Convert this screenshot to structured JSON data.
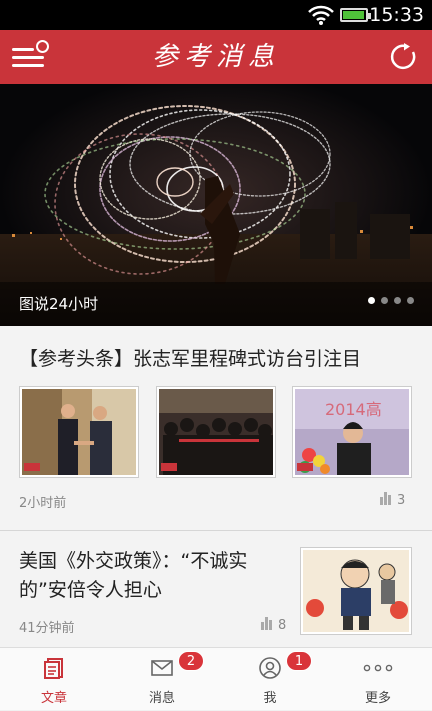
{
  "status_bar": {
    "time": "15:33",
    "battery_level": 0.95
  },
  "header": {
    "logo_text": "参考消息"
  },
  "hero": {
    "caption": "图说24小时",
    "page_dots": 4,
    "active_dot": 0
  },
  "articles": [
    {
      "title": "【参考头条】张志军里程碑式访台引注目",
      "time": "2小时前",
      "count": "3",
      "thumbnails": [
        "handshake-photo",
        "press-crowd-photo",
        "speaker-photo"
      ]
    },
    {
      "title": "美国《外交政策》：“不诚实的”安倍令人担心",
      "time": "41分钟前",
      "count": "8",
      "thumbnail": "cartoon-photo"
    }
  ],
  "tabs": [
    {
      "label": "文章",
      "active": true
    },
    {
      "label": "消息",
      "badge": "2"
    },
    {
      "label": "我",
      "badge": "1"
    },
    {
      "label": "更多"
    }
  ],
  "colors": {
    "brand_red": "#c9343a",
    "badge_red": "#d9343a"
  }
}
